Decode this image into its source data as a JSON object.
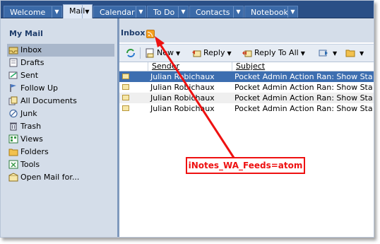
{
  "tabs": [
    {
      "label": "Welcome",
      "active": false
    },
    {
      "label": "Mail",
      "active": true
    },
    {
      "label": "Calendar",
      "active": false
    },
    {
      "label": "To Do",
      "active": false
    },
    {
      "label": "Contacts",
      "active": false
    },
    {
      "label": "Notebook",
      "active": false
    }
  ],
  "sidebar": {
    "title": "My Mail",
    "items": [
      {
        "label": "Inbox",
        "icon": "inbox-icon",
        "selected": true
      },
      {
        "label": "Drafts",
        "icon": "drafts-icon"
      },
      {
        "label": "Sent",
        "icon": "sent-icon"
      },
      {
        "label": "Follow Up",
        "icon": "flag-icon"
      },
      {
        "label": "All Documents",
        "icon": "all-documents-icon"
      },
      {
        "label": "Junk",
        "icon": "junk-icon"
      },
      {
        "label": "Trash",
        "icon": "trash-icon"
      },
      {
        "label": "Views",
        "icon": "views-icon"
      },
      {
        "label": "Folders",
        "icon": "folder-icon"
      },
      {
        "label": "Tools",
        "icon": "tools-icon"
      },
      {
        "label": "Open Mail for...",
        "icon": "open-mail-icon"
      }
    ]
  },
  "main": {
    "title": "Inbox",
    "toolbar": {
      "new_label": "New",
      "reply_label": "Reply",
      "reply_all_label": "Reply To All"
    },
    "columns": {
      "sender": "Sender",
      "subject": "Subject"
    },
    "rows": [
      {
        "sender": "Julian Robichaux",
        "subject": "Pocket Admin Action Ran: Show Sta"
      },
      {
        "sender": "Julian Robichaux",
        "subject": "Pocket Admin Action Ran: Show Sta"
      },
      {
        "sender": "Julian Robichaux",
        "subject": "Pocket Admin Action Ran: Show Sta"
      },
      {
        "sender": "Julian Robichaux",
        "subject": "Pocket Admin Action Ran: Show Sta"
      }
    ]
  },
  "annotation": {
    "text": "iNotes_WA_Feeds=atom",
    "color": "#e11111"
  },
  "colors": {
    "header_bar": "#2a4f86",
    "selection": "#3d6eb0",
    "sidebar_bg": "#d4dde9"
  }
}
